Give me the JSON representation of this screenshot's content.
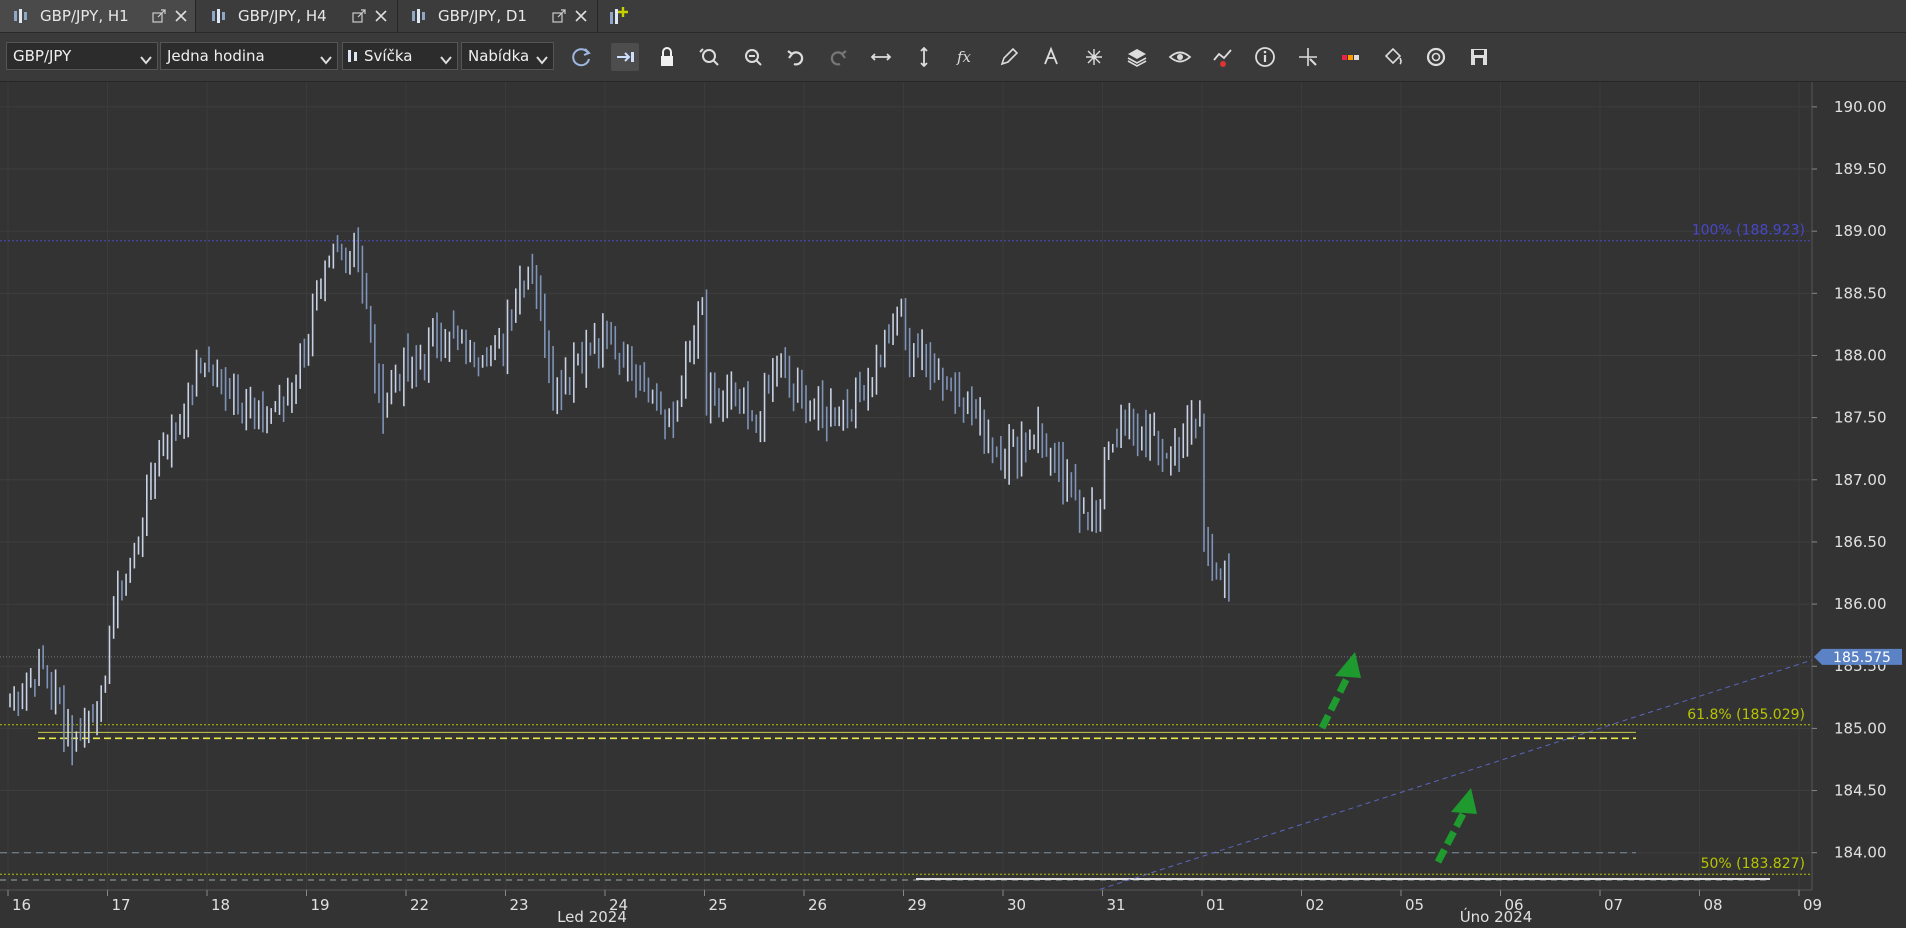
{
  "tabs": [
    {
      "label": "GBP/JPY, H1",
      "icon": "candles-icon",
      "active": true
    },
    {
      "label": "GBP/JPY, H4",
      "icon": "candles-icon",
      "active": false
    },
    {
      "label": "GBP/JPY, D1",
      "icon": "candles-icon",
      "active": false
    }
  ],
  "toolbar": {
    "instrument": "GBP/JPY",
    "period": "Jedna hodina",
    "chart_type": "Svíčka",
    "offer_side": "Nabídka",
    "icons": [
      "refresh-icon",
      "autoscroll-icon",
      "lock-icon",
      "zoom-in-icon",
      "zoom-out-icon",
      "undo-icon",
      "redo-icon",
      "horizontal-arrows-icon",
      "vertical-arrows-icon",
      "fx-indicator-icon",
      "pencil-icon",
      "text-tool-icon",
      "crosshair-nodes-icon",
      "layers-icon",
      "eye-icon",
      "alert-chart-icon",
      "info-icon",
      "cursor-cross-icon",
      "signal-bar-icon",
      "paint-bucket-icon",
      "camera-shutter-icon",
      "save-icon"
    ]
  },
  "chart_data": {
    "type": "bar",
    "instrument": "GBP/JPY",
    "timeframe": "H1",
    "ylim": [
      183.7,
      190.2
    ],
    "y_ticks": [
      "190.00",
      "189.50",
      "189.00",
      "188.50",
      "188.00",
      "187.50",
      "187.00",
      "186.50",
      "186.00",
      "185.50",
      "185.00",
      "184.50",
      "184.00"
    ],
    "x_ticks": [
      "16",
      "17",
      "18",
      "19",
      "22",
      "23",
      "24",
      "25",
      "26",
      "29",
      "30",
      "31",
      "01",
      "02",
      "05",
      "06",
      "07",
      "08",
      "09"
    ],
    "month_labels": [
      "Led 2024",
      "Úno 2024"
    ],
    "current_price": "185.575",
    "fib_levels": [
      {
        "label": "100% (188.923)",
        "price": 188.923,
        "color": "#4848c8"
      },
      {
        "label": "61.8% (185.029)",
        "price": 185.029,
        "color": "#b8c400"
      },
      {
        "label": "50% (183.827)",
        "price": 183.827,
        "color": "#b8c400"
      }
    ],
    "series": [
      {
        "x": "16",
        "values": [
          185.2,
          185.5,
          184.9,
          185.3
        ]
      },
      {
        "x": "17",
        "values": [
          185.9,
          186.4,
          187.2,
          187.5,
          188.0
        ]
      },
      {
        "x": "18",
        "values": [
          187.9,
          187.7,
          187.5,
          187.6,
          188.0
        ]
      },
      {
        "x": "19",
        "values": [
          188.2,
          188.8,
          188.9,
          187.6,
          187.9
        ]
      },
      {
        "x": "22",
        "values": [
          187.8,
          188.2,
          188.0,
          188.1
        ]
      },
      {
        "x": "23",
        "values": [
          188.3,
          188.8,
          187.7,
          188.0,
          188.1
        ]
      },
      {
        "x": "24",
        "values": [
          188.1,
          187.9,
          187.4,
          188.4
        ]
      },
      {
        "x": "25",
        "values": [
          187.6,
          187.7,
          187.4,
          187.9,
          187.6
        ]
      },
      {
        "x": "26",
        "values": [
          187.6,
          187.5,
          187.8,
          188.4
        ]
      },
      {
        "x": "29",
        "values": [
          188.1,
          187.9,
          187.6,
          187.2
        ]
      },
      {
        "x": "30",
        "values": [
          187.2,
          187.4,
          186.9,
          186.7
        ]
      },
      {
        "x": "31",
        "values": [
          187.3,
          187.4,
          187.2,
          187.5
        ]
      },
      {
        "x": "01",
        "values": [
          186.5,
          186.1,
          186.3,
          186.0,
          185.5
        ]
      }
    ]
  },
  "annotations": [
    "up-arrow-icon",
    "up-arrow-icon"
  ]
}
